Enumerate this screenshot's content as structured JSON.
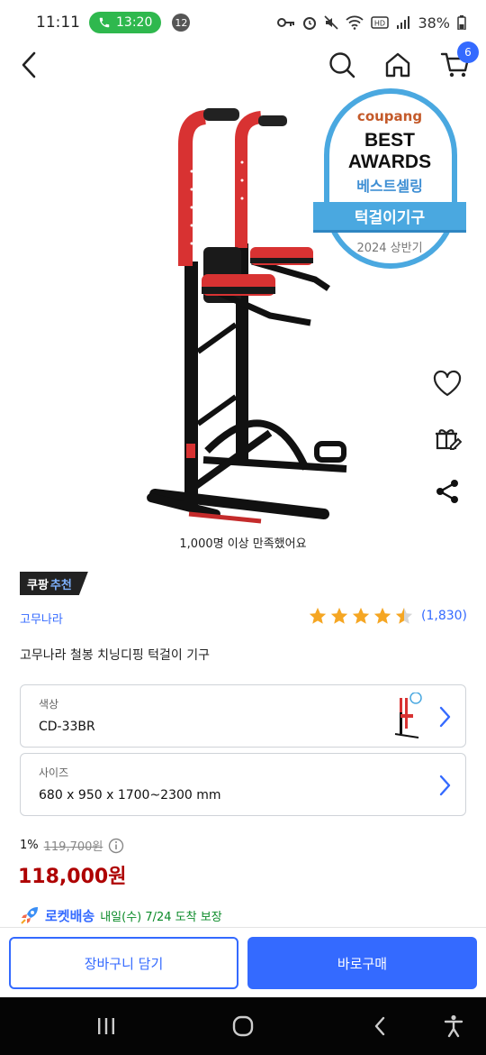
{
  "status_bar": {
    "time": "11:11",
    "call_time": "13:20",
    "notification_count": "12",
    "battery": "38%"
  },
  "header": {
    "cart_count": "6"
  },
  "award": {
    "brand": "coupang",
    "line1": "BEST",
    "line2": "AWARDS",
    "line3": "베스트셀링",
    "ribbon": "턱걸이기구",
    "year": "2024 상반기"
  },
  "product": {
    "satisfaction": "1,000명 이상 만족했어요",
    "recommend_badge_main": "쿠팡",
    "recommend_badge_accent": "추천",
    "brand": "고무나라",
    "rating": 4.5,
    "review_count": "(1,830)",
    "title": "고무나라 철봉 치닝디핑 턱걸이 기구"
  },
  "options": [
    {
      "label": "색상",
      "value": "CD-33BR"
    },
    {
      "label": "사이즈",
      "value": "680 x 950 x 1700~2300 mm"
    }
  ],
  "pricing": {
    "discount": "1%",
    "original_price": "119,700원",
    "price": "118,000원"
  },
  "delivery": {
    "label": "로켓배송",
    "text": "내일(수) 7/24 도착 보장"
  },
  "actions": {
    "add_to_cart": "장바구니 담기",
    "buy_now": "바로구매"
  },
  "colors": {
    "accent": "#346aff",
    "price": "#ae0000",
    "award_blue": "#4aa8e0"
  }
}
